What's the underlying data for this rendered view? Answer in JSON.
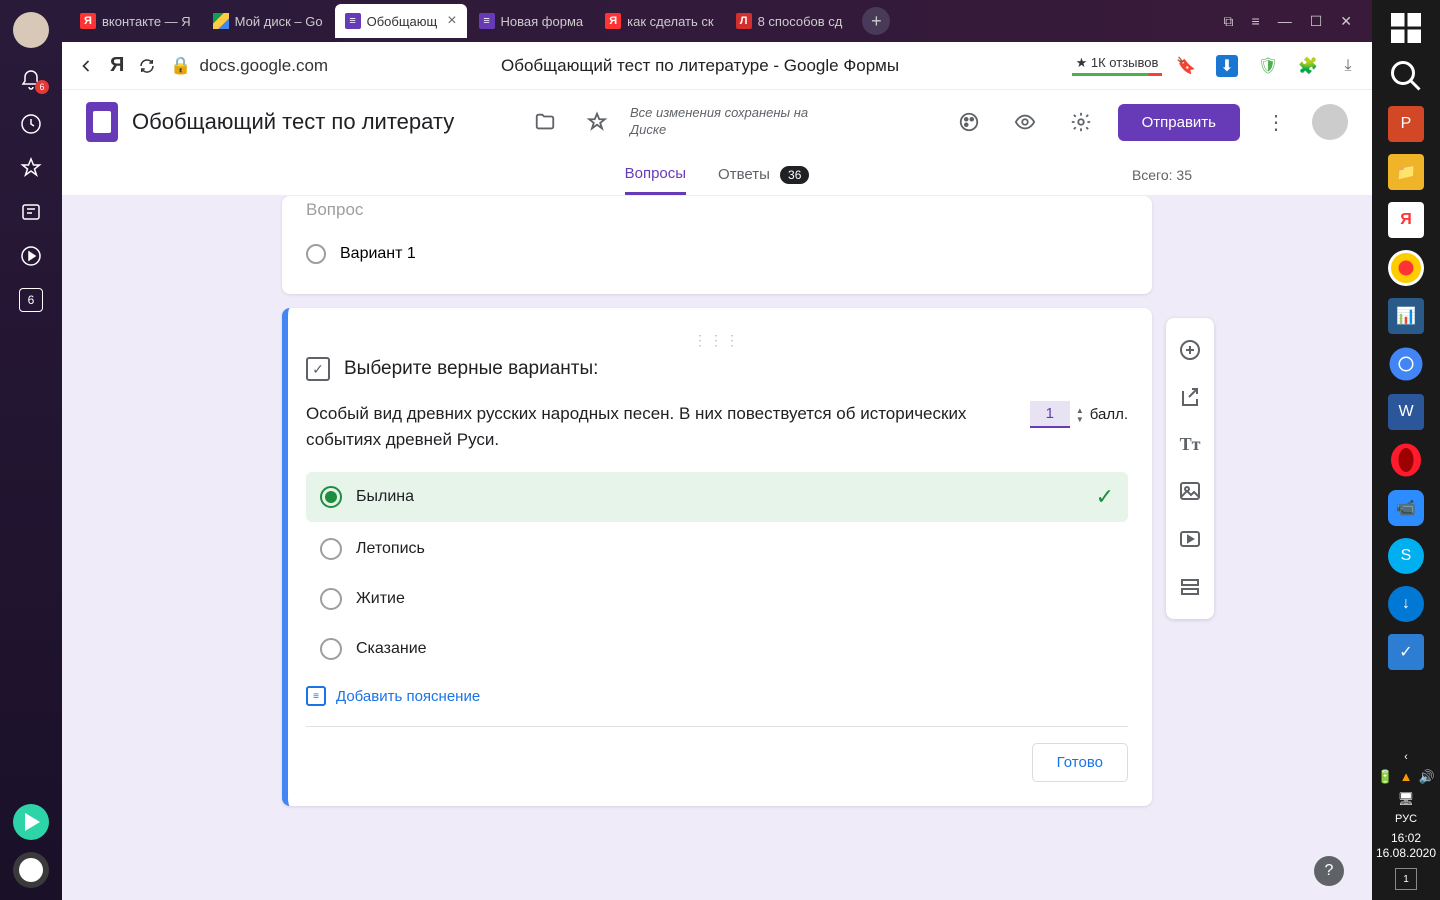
{
  "browser_sidebar": {
    "notif_badge": "6",
    "box_value": "6"
  },
  "tabs": [
    {
      "icon": "yandex",
      "label": "вконтакте — Я"
    },
    {
      "icon": "drive",
      "label": "Мой диск – Go"
    },
    {
      "icon": "forms",
      "label": "Обобщающ",
      "active": true
    },
    {
      "icon": "forms",
      "label": "Новая форма"
    },
    {
      "icon": "yandex",
      "label": "как сделать ск"
    },
    {
      "icon": "lh",
      "label": "8 способов сд"
    }
  ],
  "url": {
    "domain": "docs.google.com",
    "page_title": "Обобщающий тест по литературе - Google Формы",
    "reviews": "★ 1К отзывов"
  },
  "forms": {
    "title": "Обобщающий тест по литерату",
    "save_status": "Все изменения сохранены на Диске",
    "send_label": "Отправить",
    "tabs": {
      "questions": "Вопросы",
      "answers": "Ответы",
      "answers_count": "36"
    },
    "total": "Всего: 35"
  },
  "prev_question": {
    "title": "Вопрос",
    "option": "Вариант 1"
  },
  "question": {
    "header": "Выберите верные варианты:",
    "description": "Особый вид древних русских народных песен. В них повествуется об исторических событиях древней Руси.",
    "points_value": "1",
    "points_label": "балл.",
    "options": [
      {
        "text": "Былина",
        "correct": true
      },
      {
        "text": "Летопись",
        "correct": false
      },
      {
        "text": "Житие",
        "correct": false
      },
      {
        "text": "Сказание",
        "correct": false
      }
    ],
    "add_explanation": "Добавить пояснение",
    "done": "Готово"
  },
  "help": "?",
  "win": {
    "lang": "РУС",
    "time": "16:02",
    "date": "16.08.2020",
    "notif": "1"
  }
}
